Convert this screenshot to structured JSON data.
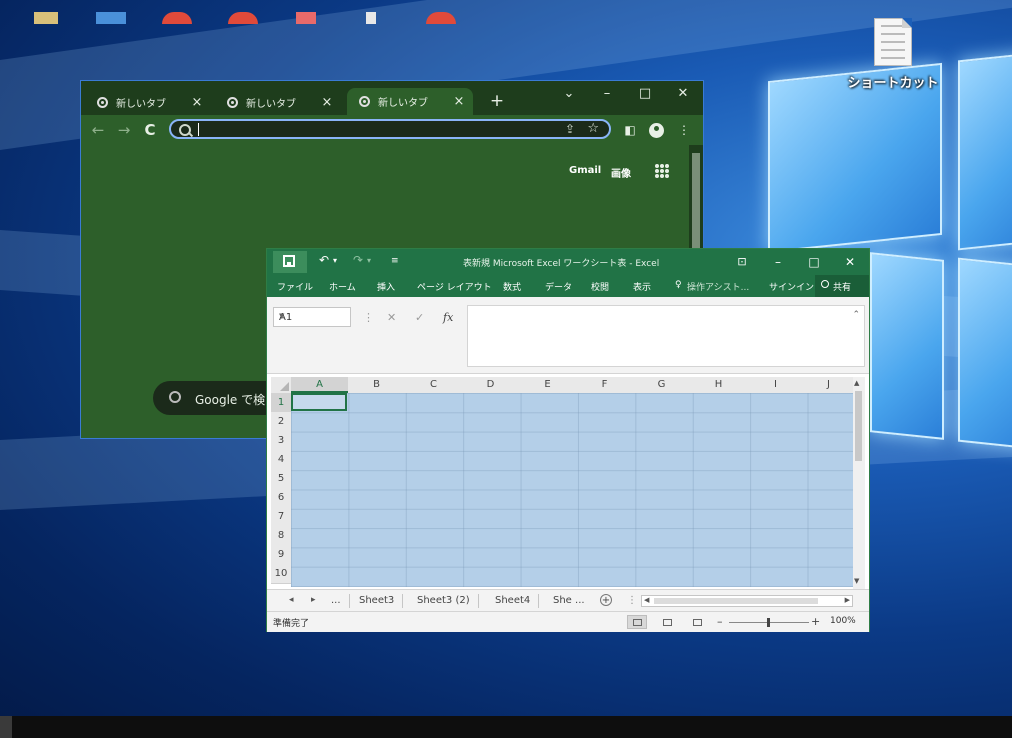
{
  "desktop": {
    "shortcut_label": "ショートカット",
    "shortcut_icon": "document-file-icon"
  },
  "chrome": {
    "tabs": [
      {
        "label": "新しいタブ",
        "active": false
      },
      {
        "label": "新しいタブ",
        "active": false
      },
      {
        "label": "新しいタブ",
        "active": true
      }
    ],
    "close_glyph": "×",
    "new_tab_glyph": "+",
    "window": {
      "dropdown": "⌄",
      "minimize": "–",
      "maximize": "□",
      "close": "✕"
    },
    "toolbar": {
      "back": "←",
      "forward": "→",
      "reload": "C"
    },
    "omnibox": {
      "value": "",
      "placeholder": ""
    },
    "header_links": {
      "gmail": "Gmail",
      "images": "画像"
    },
    "search_box_text": "Google で検"
  },
  "excel": {
    "title": "表新規 Microsoft Excel ワークシート表 - Excel",
    "quick_access": {
      "undo": "↶",
      "undo_dd": "▾",
      "redo": "↷",
      "redo_dd": "▾",
      "customize": "≡"
    },
    "window": {
      "ribbon_display": "⊡",
      "minimize": "–",
      "maximize": "□",
      "close": "✕"
    },
    "ribbon_tabs": [
      "ファイル",
      "ホーム",
      "挿入",
      "ページ レイアウト",
      "数式",
      "データ",
      "校閲",
      "表示"
    ],
    "tell_me": "操作アシスト...",
    "tell_me_icon": "♀",
    "signin": "サインイン",
    "share": "共有",
    "name_box": "A1",
    "formula_icons": {
      "more": "⋮",
      "cancel": "✕",
      "enter": "✓",
      "fx": "fx"
    },
    "formula_value": "",
    "columns": [
      "A",
      "B",
      "C",
      "D",
      "E",
      "F",
      "G",
      "H",
      "I",
      "J"
    ],
    "rows": [
      "1",
      "2",
      "3",
      "4",
      "5",
      "6",
      "7",
      "8",
      "9",
      "10"
    ],
    "selected_cell": "A1",
    "sheet_tabs": [
      "...",
      "Sheet3",
      "Sheet3 (2)",
      "Sheet4",
      "She ..."
    ],
    "sheet_nav": {
      "prev": "◂",
      "next": "▸"
    },
    "add_sheet": "+",
    "status": "準備完了",
    "zoom": {
      "minus": "–",
      "plus": "+",
      "percent": "100%"
    }
  },
  "colors": {
    "excel_green": "#217346",
    "chrome_frame": "#1e3d1c",
    "chrome_page": "#2d5f2a",
    "selection_blue": "#b4cfe8",
    "taskbar": "#0e0e0e"
  }
}
